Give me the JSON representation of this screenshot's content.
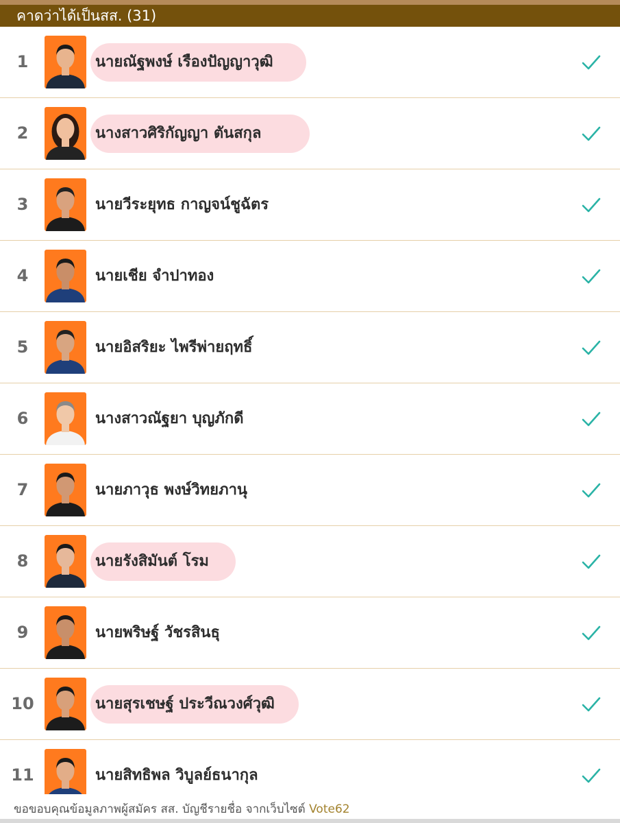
{
  "header": {
    "title": "คาดว่าได้เป็นสส. (31)"
  },
  "colors": {
    "header_bg": "#74510c",
    "photo_bg": "#ff7a1e",
    "check": "#2ab3a6",
    "highlight": "#fbd6db",
    "footer_link": "#a3832f"
  },
  "candidates": [
    {
      "rank": "1",
      "name": "นายณัฐพงษ์ เรืองปัญญาวุฒิ",
      "highlighted": true,
      "shirt": "#1e2a3c",
      "check_icon": "check-icon"
    },
    {
      "rank": "2",
      "name": "นางสาวศิริกัญญา ตันสกุล",
      "highlighted": true,
      "shirt": "#232323",
      "check_icon": "check-icon"
    },
    {
      "rank": "3",
      "name": "นายวีระยุทธ กาญจน์ชูฉัตร",
      "highlighted": false,
      "shirt": "#1c1c1c",
      "check_icon": "check-icon"
    },
    {
      "rank": "4",
      "name": "นายเชีย จำปาทอง",
      "highlighted": false,
      "shirt": "#1f3f7a",
      "check_icon": "check-icon"
    },
    {
      "rank": "5",
      "name": "นายอิสริยะ ไพรีพ่ายฤทธิ์",
      "highlighted": false,
      "shirt": "#1f3f7a",
      "check_icon": "check-icon"
    },
    {
      "rank": "6",
      "name": "นางสาวณัฐยา บุญภักดี",
      "highlighted": false,
      "shirt": "#f2f2f2",
      "check_icon": "check-icon"
    },
    {
      "rank": "7",
      "name": "นายภาวุธ พงษ์วิทยภานุ",
      "highlighted": false,
      "shirt": "#1c1c1c",
      "check_icon": "check-icon"
    },
    {
      "rank": "8",
      "name": "นายรังสิมันต์ โรม",
      "highlighted": true,
      "shirt": "#1e2a3c",
      "check_icon": "check-icon"
    },
    {
      "rank": "9",
      "name": "นายพริษฐ์ วัชรสินธุ",
      "highlighted": false,
      "shirt": "#1c1c1c",
      "check_icon": "check-icon"
    },
    {
      "rank": "10",
      "name": "นายสุรเชษฐ์ ประวีณวงศ์วุฒิ",
      "highlighted": true,
      "shirt": "#1c1c1c",
      "check_icon": "check-icon"
    },
    {
      "rank": "11",
      "name": "นายสิทธิพล วิบูลย์ธนากุล",
      "highlighted": false,
      "shirt": "#1f3f7a",
      "check_icon": "check-icon"
    }
  ],
  "footer": {
    "text": "ขอขอบคุณข้อมูลภาพผู้สมัคร สส. บัญชีรายชื่อ จากเว็บไซต์ ",
    "link": "Vote62"
  }
}
